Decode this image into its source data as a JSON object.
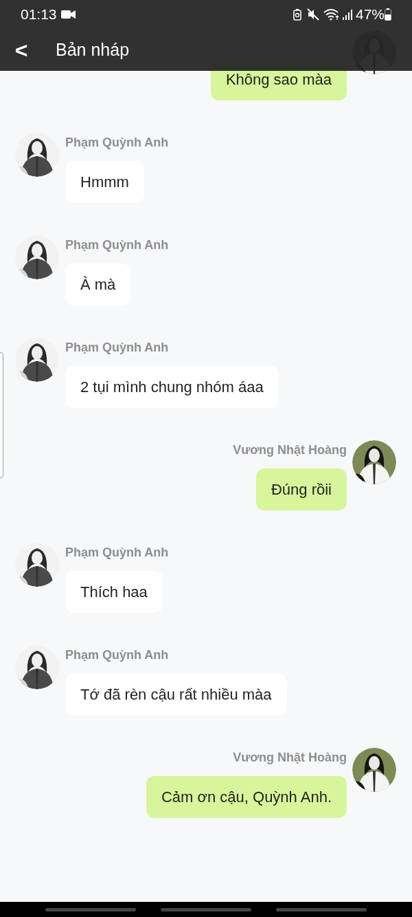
{
  "status_bar": {
    "time": "01:13",
    "battery": "47%"
  },
  "header": {
    "back": "<",
    "title": "Bản nháp"
  },
  "messages": [
    {
      "kind": "outgoing",
      "text": "Không sao màa"
    },
    {
      "kind": "incoming",
      "sender": "Phạm Quỳnh Anh",
      "text": "Hmmm"
    },
    {
      "kind": "incoming",
      "sender": "Phạm Quỳnh Anh",
      "text": "À mà"
    },
    {
      "kind": "incoming",
      "sender": "Phạm Quỳnh Anh",
      "text": "2 tụi mình chung nhóm áaa"
    },
    {
      "kind": "outgoing",
      "sender": "Vương Nhật Hoàng",
      "text": "Đúng rồii"
    },
    {
      "kind": "incoming",
      "sender": "Phạm Quỳnh Anh",
      "text": "Thích haa"
    },
    {
      "kind": "incoming",
      "sender": "Phạm Quỳnh Anh",
      "text": "Tớ đã rèn cậu rất nhiều màa"
    },
    {
      "kind": "outgoing",
      "sender": "Vương Nhật Hoàng",
      "text": "Cảm ơn cậu, Quỳnh Anh."
    }
  ]
}
